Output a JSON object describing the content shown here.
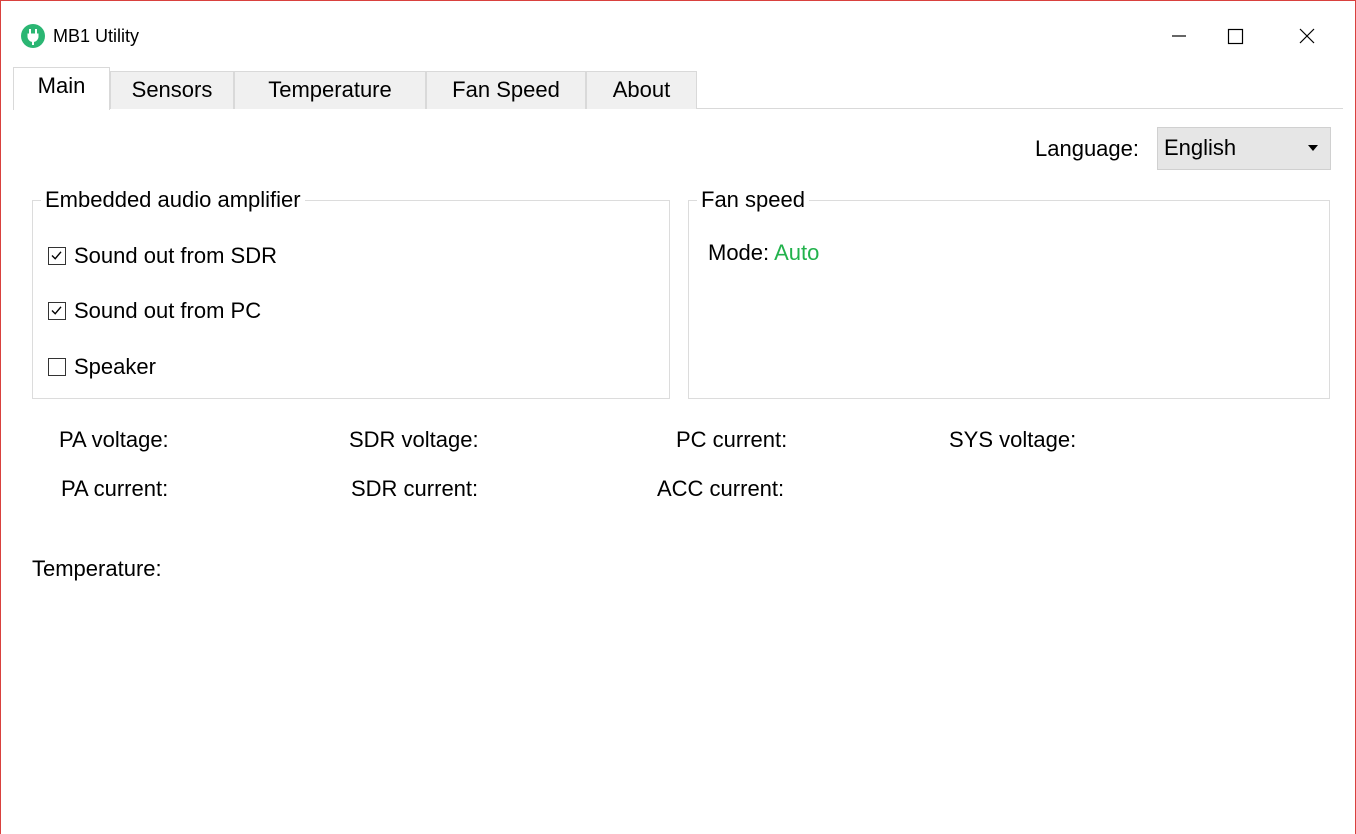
{
  "window": {
    "title": "MB1 Utility",
    "icon": "plug-icon",
    "border_color": "#d9413e"
  },
  "tabs": [
    {
      "label": "Main",
      "active": true
    },
    {
      "label": "Sensors",
      "active": false
    },
    {
      "label": "Temperature",
      "active": false
    },
    {
      "label": "Fan Speed",
      "active": false
    },
    {
      "label": "About",
      "active": false
    }
  ],
  "language": {
    "label": "Language:",
    "selected": "English"
  },
  "audio_group": {
    "title": "Embedded audio amplifier",
    "options": [
      {
        "label": "Sound out from SDR",
        "checked": true
      },
      {
        "label": "Sound out from PC",
        "checked": true
      },
      {
        "label": "Speaker",
        "checked": false
      }
    ]
  },
  "fan_group": {
    "title": "Fan speed",
    "mode_label": "Mode:",
    "mode_value": "Auto",
    "mode_color": "#22b24c"
  },
  "metrics": {
    "pa_voltage": "PA voltage:",
    "sdr_voltage": "SDR voltage:",
    "pc_current": "PC current:",
    "sys_voltage": "SYS voltage:",
    "pa_current": "PA current:",
    "sdr_current": "SDR current:",
    "acc_current": "ACC current:",
    "temperature": "Temperature:"
  }
}
